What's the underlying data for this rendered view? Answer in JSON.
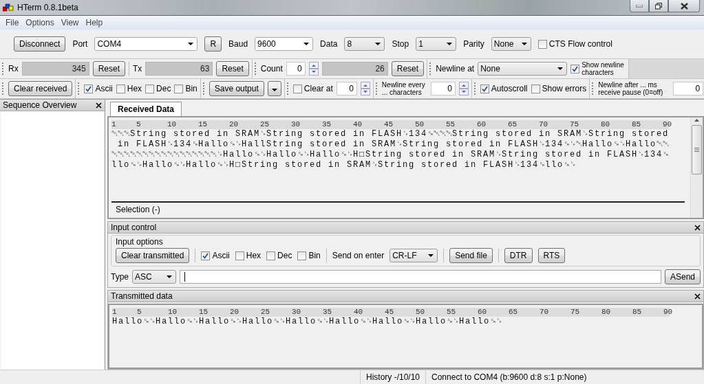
{
  "window": {
    "title": "HTerm 0.8.1beta"
  },
  "menu": [
    {
      "label": "File"
    },
    {
      "label": "Options"
    },
    {
      "label": "View"
    },
    {
      "label": "Help"
    }
  ],
  "connection": {
    "connect_button": "Disconnect",
    "port_label": "Port",
    "port": "COM4",
    "refresh_button": "R",
    "baud_label": "Baud",
    "baud": "9600",
    "data_label": "Data",
    "data": "8",
    "stop_label": "Stop",
    "stop": "1",
    "parity_label": "Parity",
    "parity": "None",
    "cts_flow_control": {
      "label": "CTS Flow control",
      "checked": false
    }
  },
  "counters": {
    "rx_label": "Rx",
    "rx": "345",
    "rx_reset": "Reset",
    "tx_label": "Tx",
    "tx": "63",
    "tx_reset": "Reset",
    "count_label": "Count",
    "count": "0",
    "count_total": "26",
    "count_reset": "Reset",
    "newline_at_label": "Newline at",
    "newline_at": "None",
    "show_newline_characters": {
      "label": "Show newline characters",
      "checked": true
    }
  },
  "receive_options": {
    "clear_button": "Clear received",
    "formats": [
      {
        "label": "Ascii",
        "checked": true
      },
      {
        "label": "Hex",
        "checked": false
      },
      {
        "label": "Dec",
        "checked": false
      },
      {
        "label": "Bin",
        "checked": false
      }
    ],
    "save_button": "Save output",
    "clear_at": {
      "label": "Clear at",
      "checked": false,
      "value": "0"
    },
    "newline_every": {
      "label": "Newline every ... characters",
      "value": "0"
    },
    "autoscroll": {
      "label": "Autoscroll",
      "checked": true
    },
    "show_errors": {
      "label": "Show errors",
      "checked": false
    },
    "newline_after": {
      "label": "Newline after ... ms receive pause (0=off)",
      "value": "0"
    }
  },
  "sequence_panel": {
    "title": "Sequence Overview"
  },
  "received": {
    "tabs": [
      {
        "label": "Received Data",
        "selected": true
      }
    ],
    "ruler": [
      "1",
      "5",
      "10",
      "15",
      "20",
      "25",
      "30",
      "35",
      "40",
      "45",
      "50",
      "55",
      "60",
      "65",
      "70",
      "75",
      "80",
      "85",
      "90"
    ],
    "lines": [
      "␀␀␀String stored in SRAM␊String stored in FLASH␊134␍␀␀␀String stored in SRAM␊String stored",
      " in FLASH␊134␍Hallo␍␊HallString stored in SRAM␊String stored in FLASH␊134␍␊␀Hallo␍␊Hallo␀␀",
      "␀␀␀␀␀␀␀␀␀␀␀␀␀␀␀␀␀␊Hallo␍␊Hallo␍␊Hallo␍␊H□String stored in SRAM␊String stored in FLASH␊134␍",
      "llo␍␊Hallo␍␊Hallo␍␊H□String stored in SRAM␊String stored in FLASH␊134␍llo␍␊"
    ],
    "selection": "Selection (-)"
  },
  "input_control": {
    "title": "Input control",
    "group_title": "Input options",
    "clear_button": "Clear transmitted",
    "formats": [
      {
        "label": "Ascii",
        "checked": true
      },
      {
        "label": "Hex",
        "checked": false
      },
      {
        "label": "Dec",
        "checked": false
      },
      {
        "label": "Bin",
        "checked": false
      }
    ],
    "send_on_enter_label": "Send on enter",
    "send_on_enter": "CR-LF",
    "send_file_button": "Send file",
    "dtr_button": "DTR",
    "rts_button": "RTS",
    "type_label": "Type",
    "type": "ASC",
    "send_button": "ASend"
  },
  "transmitted": {
    "title": "Transmitted data",
    "ruler": [
      "1",
      "5",
      "10",
      "15",
      "20",
      "25",
      "30",
      "35",
      "40",
      "45",
      "50",
      "55",
      "60",
      "65",
      "70",
      "75",
      "80",
      "85",
      "90"
    ],
    "lines": [
      "Hallo␍␊Hallo␍␊Hallo␍␊Hallo␍␊Hallo␍␊Hallo␍␊Hallo␍␊Hallo␍␊Hallo␍␊"
    ]
  },
  "status_bar": [
    {
      "text": "History -/10/10"
    },
    {
      "text": "Connect to COM4 (b:9600 d:8 s:1 p:None)"
    }
  ]
}
